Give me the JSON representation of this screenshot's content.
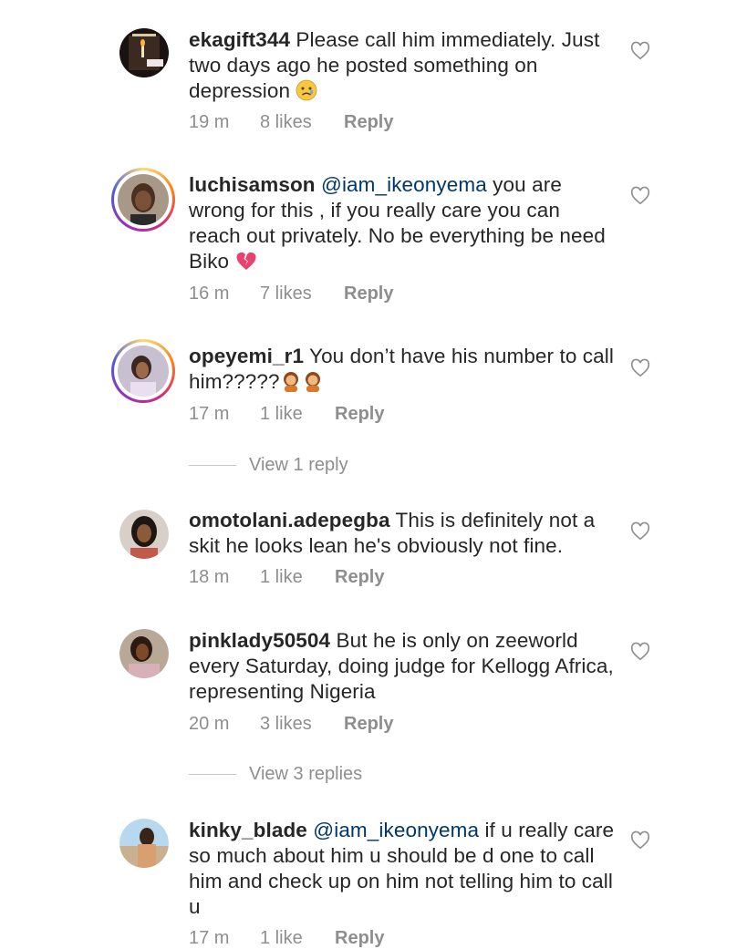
{
  "comments": [
    {
      "username": "ekagift344",
      "segments": [
        {
          "text": "Please call him immediately. Just two days ago he posted something on depression "
        }
      ],
      "emoji": "sad-face-emoji",
      "time": "19 m",
      "likes": "8 likes",
      "reply": "Reply"
    },
    {
      "username": "luchisamson",
      "mention": "@iam_ikeonyema",
      "segments": [
        {
          "text": " you are wrong for this , if you really care you can reach out privately. No be everything be need Biko "
        }
      ],
      "emoji": "broken-heart-emoji",
      "time": "16 m",
      "likes": "7 likes",
      "reply": "Reply"
    },
    {
      "username": "opeyemi_r1",
      "segments": [
        {
          "text": "You don’t have his number to call him?????"
        }
      ],
      "emoji": "woman-pouting-emoji",
      "time": "17 m",
      "likes": "1 like",
      "reply": "Reply",
      "view_replies": "View 1 reply"
    },
    {
      "username": "omotolani.adepegba",
      "segments": [
        {
          "text": "This is definitely not a skit he looks lean  he's obviously not fine."
        }
      ],
      "time": "18 m",
      "likes": "1 like",
      "reply": "Reply"
    },
    {
      "username": "pinklady50504",
      "segments": [
        {
          "text": "But he is only on zeeworld every Saturday, doing judge for Kellogg Africa, representing Nigeria"
        }
      ],
      "time": "20 m",
      "likes": "3 likes",
      "reply": "Reply",
      "view_replies": "View 3 replies"
    },
    {
      "username": "kinky_blade",
      "mention": "@iam_ikeonyema",
      "segments": [
        {
          "text": " if u really care so much about him  u should be d one to call him and check up on him not telling him to call u"
        }
      ],
      "time": "17 m",
      "likes": "1 like",
      "reply": "Reply"
    }
  ],
  "icons": {
    "like": "heart-outline-icon"
  },
  "colors": {
    "username": "#262626",
    "mention": "#00376b",
    "meta": "#8e8e8e",
    "story_ring": "#d62976"
  }
}
